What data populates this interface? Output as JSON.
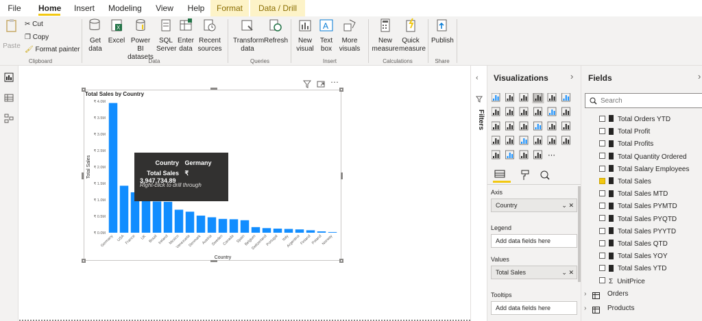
{
  "tabs": [
    "File",
    "Home",
    "Insert",
    "Modeling",
    "View",
    "Help",
    "Format",
    "Data / Drill"
  ],
  "ribbon": {
    "clipboard": {
      "paste": "Paste",
      "cut": "Cut",
      "copy": "Copy",
      "format_painter": "Format painter",
      "group": "Clipboard"
    },
    "data": {
      "get_data": "Get data",
      "excel": "Excel",
      "power_bi_datasets": "Power BI datasets",
      "sql_server": "SQL Server",
      "enter_data": "Enter data",
      "recent_sources": "Recent sources",
      "group": "Data"
    },
    "queries": {
      "transform": "Transform data",
      "refresh": "Refresh",
      "group": "Queries"
    },
    "insert": {
      "new_visual": "New visual",
      "text_box": "Text box",
      "more_visuals": "More visuals",
      "group": "Insert"
    },
    "calculations": {
      "new_measure": "New measure",
      "quick_measure": "Quick measure",
      "group": "Calculations"
    },
    "share": {
      "publish": "Publish",
      "group": "Share"
    }
  },
  "filters_label": "Filters",
  "chart_data": {
    "type": "bar",
    "title": "Total Sales by Country",
    "xlabel": "Country",
    "ylabel": "Total Sales",
    "categories": [
      "Germany",
      "USA",
      "France",
      "UK",
      "Brazil",
      "Ireland",
      "Mexico",
      "Venezuela",
      "Denmark",
      "Austria",
      "Sweden",
      "Canada",
      "Spain",
      "Belgium",
      "Switzerland",
      "Portugal",
      "Italy",
      "Argentina",
      "Finland",
      "Poland",
      "Norway"
    ],
    "values": [
      3947734.89,
      1430000,
      1230000,
      1060000,
      950000,
      940000,
      700000,
      640000,
      520000,
      470000,
      420000,
      410000,
      380000,
      170000,
      140000,
      125000,
      115000,
      100000,
      75000,
      40000,
      20000
    ],
    "yticks": [
      "₹ 0.0M",
      "₹ 0.5M",
      "₹ 1.0M",
      "₹ 1.5M",
      "₹ 2.0M",
      "₹ 2.5M",
      "₹ 3.0M",
      "₹ 3.5M",
      "₹ 4.0M"
    ],
    "ylim": [
      0,
      4000000
    ],
    "color": "#118dff"
  },
  "tooltip": {
    "country_label": "Country",
    "country_value": "Germany",
    "sales_label": "Total Sales",
    "sales_value": "₹ 3,947,734.89",
    "hint": "Right-click to drill through"
  },
  "visualizations": {
    "title": "Visualizations",
    "wells": [
      {
        "title": "Axis",
        "value": "Country",
        "filled": true
      },
      {
        "title": "Legend",
        "value": "Add data fields here",
        "filled": false
      },
      {
        "title": "Values",
        "value": "Total Sales",
        "filled": true
      },
      {
        "title": "Tooltips",
        "value": "Add data fields here",
        "filled": false
      }
    ]
  },
  "fields": {
    "title": "Fields",
    "search_placeholder": "Search",
    "items": [
      {
        "label": "Total Orders YTD",
        "checked": false
      },
      {
        "label": "Total Profit",
        "checked": false
      },
      {
        "label": "Total Profits",
        "checked": false
      },
      {
        "label": "Total Quantity Ordered",
        "checked": false
      },
      {
        "label": "Total Salary Employees",
        "checked": false
      },
      {
        "label": "Total Sales",
        "checked": true
      },
      {
        "label": "Total Sales MTD",
        "checked": false
      },
      {
        "label": "Total Sales PYMTD",
        "checked": false
      },
      {
        "label": "Total Sales PYQTD",
        "checked": false
      },
      {
        "label": "Total Sales PYYTD",
        "checked": false
      },
      {
        "label": "Total Sales QTD",
        "checked": false
      },
      {
        "label": "Total Sales YOY",
        "checked": false
      },
      {
        "label": "Total Sales YTD",
        "checked": false
      },
      {
        "label": "UnitPrice",
        "checked": false,
        "sigma": true
      }
    ],
    "tables": [
      "Orders",
      "Products"
    ]
  }
}
